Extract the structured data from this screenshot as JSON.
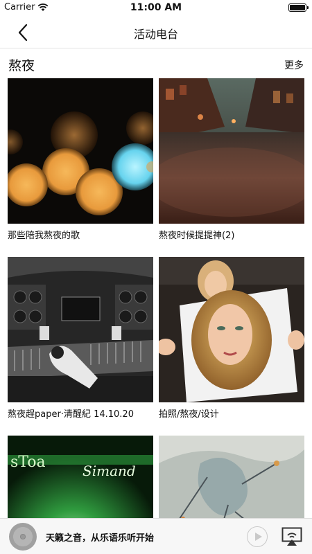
{
  "status_bar": {
    "carrier": "Carrier",
    "time": "11:00 AM"
  },
  "nav": {
    "title": "活动电台"
  },
  "section": {
    "title": "熬夜",
    "more": "更多"
  },
  "cards": [
    {
      "title": "那些陪我熬夜的歌",
      "thumb": "bokeh-lights"
    },
    {
      "title": "熬夜时候提提神(2)",
      "thumb": "night-street"
    },
    {
      "title": "熬夜趕paper·清醒紀 14.10.20",
      "thumb": "recording-studio"
    },
    {
      "title": "拍照/熬夜/设计",
      "thumb": "portrait-poster"
    },
    {
      "title": "",
      "thumb": "green-album-art",
      "thumb_text_1": "sToa",
      "thumb_text_2": "Simand"
    },
    {
      "title": "",
      "thumb": "sketch-art"
    }
  ],
  "player": {
    "text": "天籁之音，从乐语乐听开始"
  }
}
